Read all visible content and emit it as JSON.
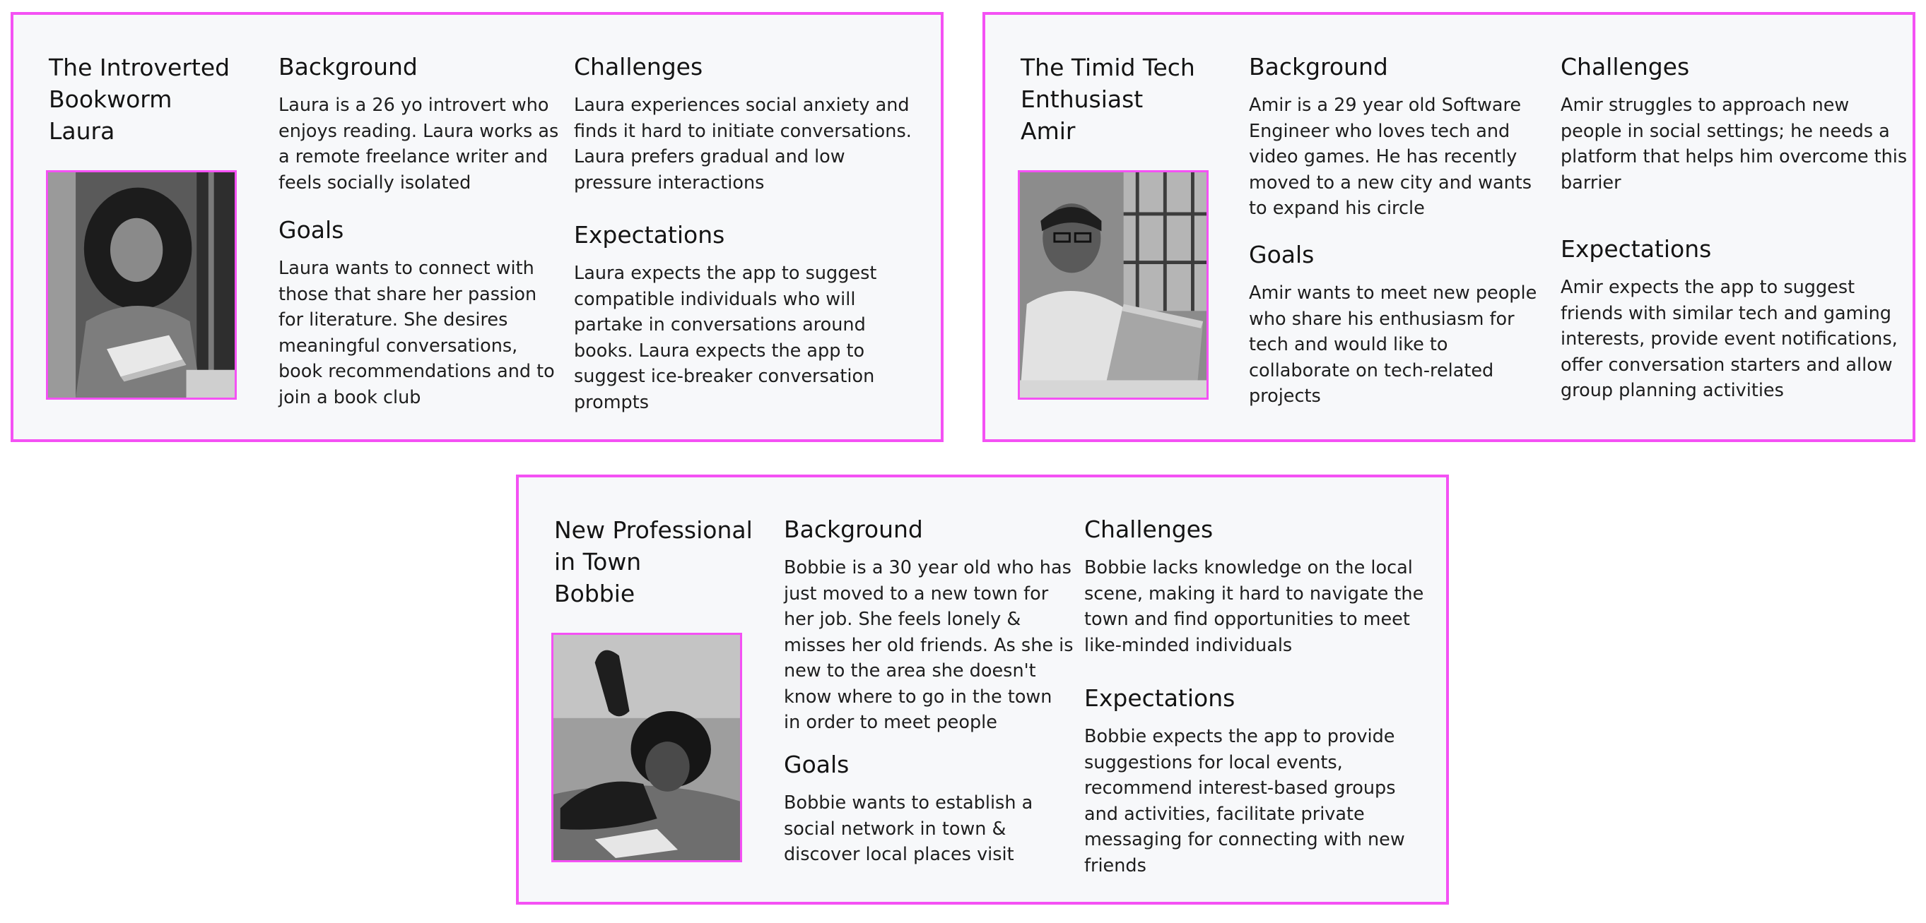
{
  "personas": [
    {
      "title": "The Introverted Bookworm",
      "name": "Laura",
      "photo_icon": "person-reading-photo",
      "background_heading": "Background",
      "background": "Laura is a 26 yo introvert who enjoys reading. Laura works as a remote freelance writer and feels socially isolated",
      "goals_heading": "Goals",
      "goals": "Laura wants to connect with those that share her passion for literature. She desires meaningful conversations, book recommendations and to join a book club",
      "challenges_heading": "Challenges",
      "challenges": "Laura experiences social anxiety and finds it hard to initiate conversations. Laura prefers gradual and low pressure interactions",
      "expectations_heading": "Expectations",
      "expectations": "Laura expects the app to suggest compatible individuals who will partake in conversations around books. Laura expects the app to suggest ice-breaker conversation prompts"
    },
    {
      "title": "The Timid Tech Enthusiast",
      "name": "Amir",
      "photo_icon": "person-laptop-photo",
      "background_heading": "Background",
      "background": "Amir is a 29 year old Software Engineer who loves tech and video games. He has recently moved to a new city and wants to expand his circle",
      "goals_heading": "Goals",
      "goals": "Amir wants to meet new people who share his enthusiasm for tech and would like to collaborate on tech-related projects",
      "challenges_heading": "Challenges",
      "challenges": "Amir struggles to approach new people in social settings; he needs a platform that helps him overcome this barrier",
      "expectations_heading": "Expectations",
      "expectations": "Amir expects the app to suggest friends with similar tech and gaming interests, provide event notifications, offer conversation starters and allow group planning activities"
    },
    {
      "title": "New Professional in Town",
      "name": "Bobbie",
      "photo_icon": "person-lying-reading-photo",
      "background_heading": "Background",
      "background": "Bobbie is a 30 year old who has just moved to a new town for her job. She feels lonely & misses her old friends. As she is new to the area she doesn't know where to go in the town in order to meet people",
      "goals_heading": "Goals",
      "goals": "Bobbie wants to establish a social network in town & discover local places visit",
      "challenges_heading": "Challenges",
      "challenges": "Bobbie lacks knowledge on the local scene, making it hard to navigate the town and find opportunities to meet like-minded individuals",
      "expectations_heading": "Expectations",
      "expectations": "Bobbie expects the app to provide suggestions for local events, recommend interest-based groups and activities, facilitate private messaging for connecting with new friends"
    }
  ],
  "colors": {
    "card_border": "#f451f4",
    "card_background": "#f7f8fa",
    "text": "#141414"
  }
}
